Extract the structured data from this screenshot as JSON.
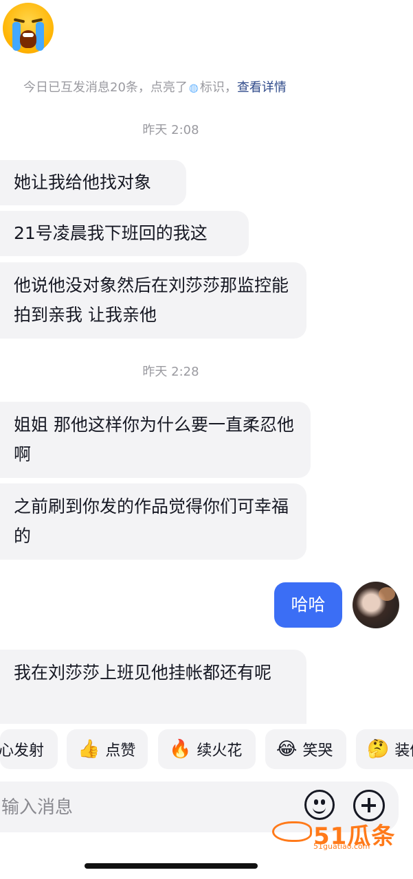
{
  "notice": {
    "text": "今日已互发消息20条，点亮了",
    "badge_text": "标识，",
    "link": "查看详情"
  },
  "timestamps": [
    "昨天 2:08",
    "昨天 2:28"
  ],
  "messages_group1": [
    "她让我给他找对象",
    "21号凌晨我下班回的我这",
    "他说他没对象然后在刘莎莎那监控能拍到亲我 让我亲他"
  ],
  "messages_group2": [
    "姐姐 那他这样你为什么要一直柔忍他啊",
    "之前刷到你发的作品觉得你们可幸福的"
  ],
  "outgoing_message": "哈哈",
  "last_incoming": "我在刘莎莎上班见他挂帐都还有呢",
  "quick_replies": [
    {
      "label": "心发射",
      "icon": "heart-icon"
    },
    {
      "label": "点赞",
      "icon": "thumbs-up-icon"
    },
    {
      "label": "续火花",
      "icon": "fire-icon"
    },
    {
      "label": "笑哭",
      "icon": "laugh-cry-icon"
    },
    {
      "label": "装傻",
      "icon": "thinking-icon"
    }
  ],
  "input": {
    "placeholder": "输入消息"
  },
  "watermark": {
    "main": "51瓜条",
    "sub": "51guatiao.com"
  },
  "colors": {
    "accent": "#3b6ef5",
    "bubble_in": "#f3f3f5",
    "timestamp": "#9a9aa0",
    "watermark": "#ff7a1a"
  }
}
